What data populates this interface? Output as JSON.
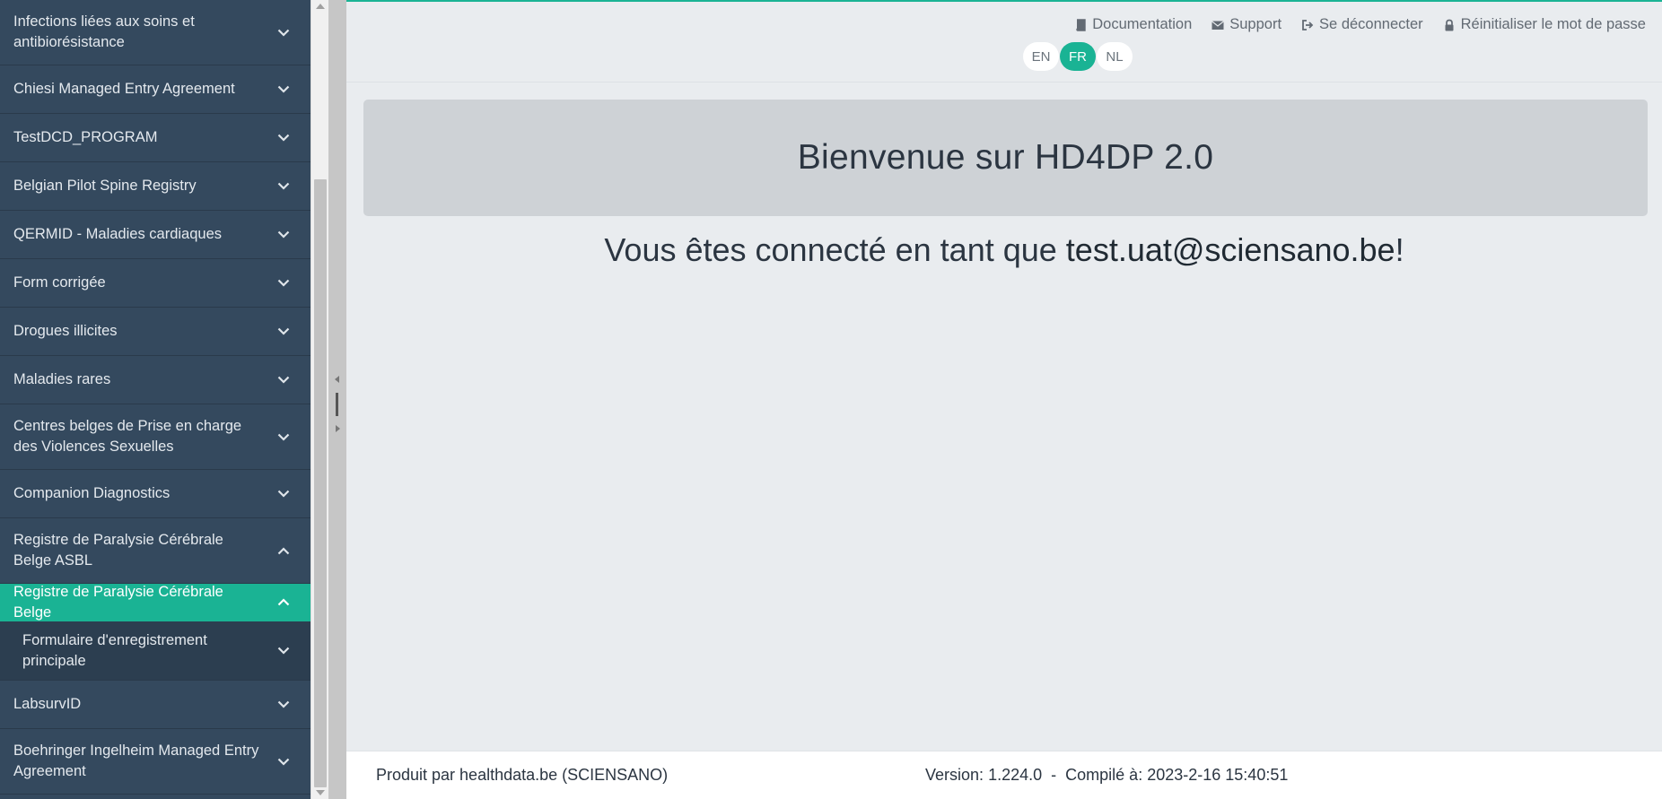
{
  "sidebar": {
    "items": [
      {
        "label": "Infections liées aux soins et antibiorésistance",
        "state": "collapsed"
      },
      {
        "label": "Chiesi Managed Entry Agreement",
        "state": "collapsed"
      },
      {
        "label": "TestDCD_PROGRAM",
        "state": "collapsed"
      },
      {
        "label": "Belgian Pilot Spine Registry",
        "state": "collapsed"
      },
      {
        "label": "QERMID - Maladies cardiaques",
        "state": "collapsed"
      },
      {
        "label": "Form corrigée",
        "state": "collapsed"
      },
      {
        "label": "Drogues illicites",
        "state": "collapsed"
      },
      {
        "label": "Maladies rares",
        "state": "collapsed"
      },
      {
        "label": "Centres belges de Prise en charge des Violences Sexuelles",
        "state": "collapsed"
      },
      {
        "label": "Companion Diagnostics",
        "state": "collapsed"
      },
      {
        "label": "Registre de Paralysie Cérébrale Belge ASBL",
        "state": "expanded"
      },
      {
        "label": "Registre de Paralysie Cérébrale Belge",
        "state": "expanded-active"
      },
      {
        "label": "Formulaire d'enregistrement principale",
        "state": "sub-collapsed"
      },
      {
        "label": "LabsurvID",
        "state": "collapsed"
      },
      {
        "label": "Boehringer Ingelheim Managed Entry Agreement",
        "state": "collapsed"
      }
    ]
  },
  "header": {
    "links": {
      "documentation": "Documentation",
      "support": "Support",
      "logout": "Se déconnecter",
      "reset_password": "Réinitialiser le mot de passe"
    },
    "languages": [
      "EN",
      "FR",
      "NL"
    ],
    "active_language": "FR"
  },
  "main": {
    "welcome_title": "Bienvenue sur HD4DP 2.0",
    "logged_prefix": "Vous êtes connecté en tant que ",
    "logged_user": "test.uat@sciensano.be",
    "logged_suffix": "!"
  },
  "footer": {
    "produced_by": "Produit par healthdata.be (SCIENSANO)",
    "version_label": "Version:",
    "version": "1.224.0",
    "separator": "-",
    "compiled_label": "Compilé à:",
    "compiled_at": "2023-2-16 15:40:51"
  },
  "colors": {
    "sidebar_bg": "#34495e",
    "accent": "#1ab394",
    "main_bg": "#e9ecef"
  }
}
